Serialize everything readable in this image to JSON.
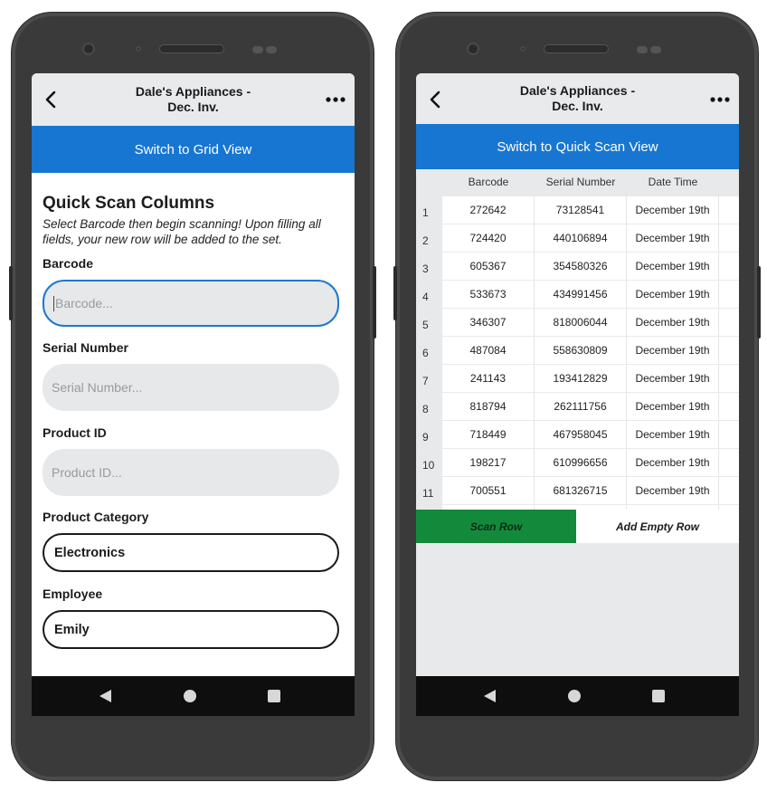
{
  "left_screen": {
    "header": {
      "title_line1": "Dale's Appliances -",
      "title_line2": "Dec. Inv."
    },
    "switch_label": "Switch to Grid View",
    "form": {
      "title": "Quick Scan Columns",
      "subtitle": "Select Barcode then begin scanning! Upon filling all fields, your new row will be added to the set.",
      "barcode": {
        "label": "Barcode",
        "placeholder": "Barcode..."
      },
      "serial": {
        "label": "Serial Number",
        "placeholder": "Serial Number..."
      },
      "product_id": {
        "label": "Product ID",
        "placeholder": "Product ID..."
      },
      "category": {
        "label": "Product Category",
        "value": "Electronics"
      },
      "employee": {
        "label": "Employee",
        "value": "Emily"
      }
    }
  },
  "right_screen": {
    "header": {
      "title_line1": "Dale's Appliances -",
      "title_line2": "Dec. Inv."
    },
    "switch_label": "Switch to Quick Scan View",
    "columns": [
      "Barcode",
      "Serial Number",
      "Date Time"
    ],
    "rows": [
      {
        "num": "1",
        "barcode": "272642",
        "serial": "73128541",
        "date": "December 19th"
      },
      {
        "num": "2",
        "barcode": "724420",
        "serial": "440106894",
        "date": "December 19th"
      },
      {
        "num": "3",
        "barcode": "605367",
        "serial": "354580326",
        "date": "December 19th"
      },
      {
        "num": "4",
        "barcode": "533673",
        "serial": "434991456",
        "date": "December 19th"
      },
      {
        "num": "5",
        "barcode": "346307",
        "serial": "818006044",
        "date": "December 19th"
      },
      {
        "num": "6",
        "barcode": "487084",
        "serial": "558630809",
        "date": "December 19th"
      },
      {
        "num": "7",
        "barcode": "241143",
        "serial": "193412829",
        "date": "December 19th"
      },
      {
        "num": "8",
        "barcode": "818794",
        "serial": "262111756",
        "date": "December 19th"
      },
      {
        "num": "9",
        "barcode": "718449",
        "serial": "467958045",
        "date": "December 19th"
      },
      {
        "num": "10",
        "barcode": "198217",
        "serial": "610996656",
        "date": "December 19th"
      },
      {
        "num": "11",
        "barcode": "700551",
        "serial": "681326715",
        "date": "December 19th"
      }
    ],
    "buttons": {
      "scan": "Scan Row",
      "add": "Add Empty Row"
    }
  },
  "colors": {
    "accent_blue": "#1776d1",
    "scan_green": "#138a3b",
    "focus_border": "#1e78cf"
  },
  "icons": [
    "back-chevron-icon",
    "more-dots-icon",
    "nav-back-icon",
    "nav-home-icon",
    "nav-recent-icon"
  ]
}
